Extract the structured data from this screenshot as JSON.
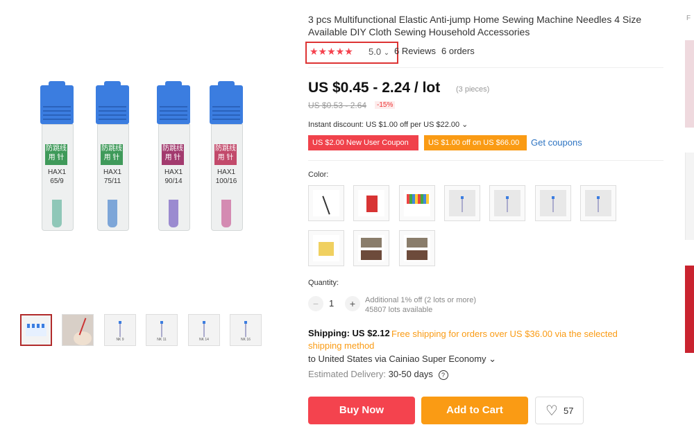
{
  "product": {
    "title": "3 pcs Multifunctional Elastic Anti-jump Home Sewing Machine Needles 4 Size Available DIY Cloth Sewing Household Accessories",
    "tubes": [
      {
        "label": "防跳线\n用 针",
        "code": "HAX1\n65/9",
        "label_color": "#3f9a5a",
        "needle_color": "#8fc7b8"
      },
      {
        "label": "防跳线\n用 针",
        "code": "HAX1\n75/11",
        "label_color": "#3f9a5a",
        "needle_color": "#7da6d8"
      },
      {
        "label": "防跳线\n用 针",
        "code": "HAX1\n90/14",
        "label_color": "#a23a6e",
        "needle_color": "#9b8bd0"
      },
      {
        "label": "防跳线\n用 针",
        "code": "HAX1\n100/16",
        "label_color": "#c24a6b",
        "needle_color": "#d48bb2"
      }
    ]
  },
  "rating": {
    "stars": "★★★★★",
    "value": "5.0",
    "chevron": "⌄",
    "reviews": "6 Reviews",
    "orders": "6 orders"
  },
  "price": {
    "current": "US $0.45 - 2.24 / lot",
    "pieces": "(3 pieces)",
    "old": "US $0.53 - 2.64",
    "discount": "-15%"
  },
  "instant_discount": "Instant discount: US $1.00 off per US $22.00 ⌄",
  "coupons": {
    "new_user": "US $2.00 New User Coupon",
    "off": "US $1.00 off on US $66.00",
    "get": "Get coupons"
  },
  "color_label": "Color:",
  "quantity": {
    "label": "Quantity:",
    "minus": "−",
    "value": "1",
    "plus": "+",
    "note1": "Additional 1% off (2 lots or more)",
    "note2": "45807 lots available"
  },
  "shipping": {
    "label": "Shipping: US $2.12",
    "free": "Free shipping for orders over US $36.00 via the selected shipping method",
    "dest": "to United States via Cainiao Super Economy ⌄",
    "est_label": "Estimated Delivery:",
    "est_value": "30-50 days",
    "help_icon": "?"
  },
  "actions": {
    "buy": "Buy Now",
    "cart": "Add to Cart",
    "wish_count": "57",
    "heart": "♡"
  },
  "side_letter": "F"
}
